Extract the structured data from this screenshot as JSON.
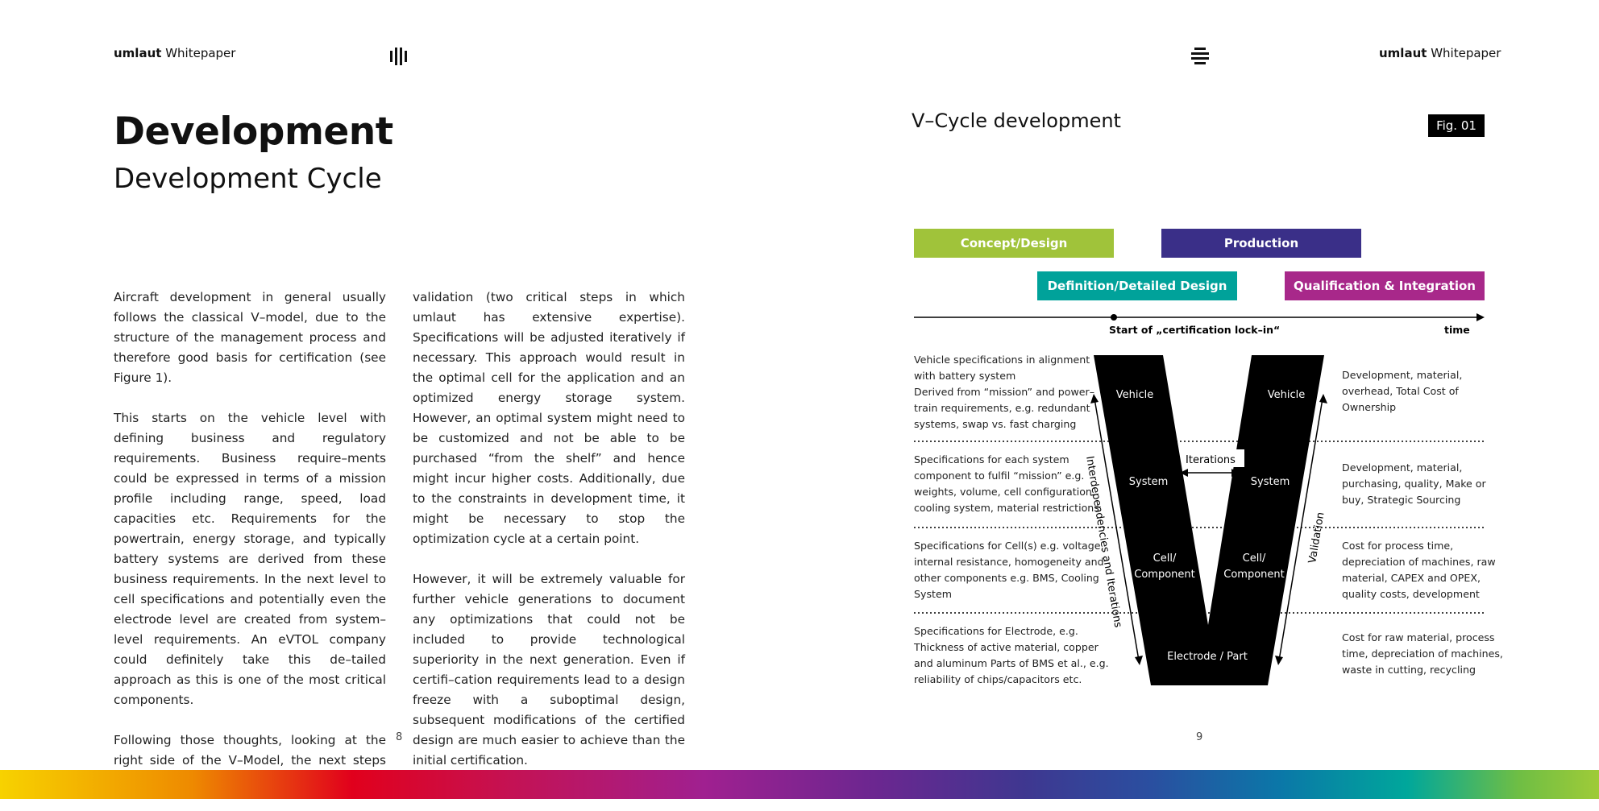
{
  "header": {
    "brand": "umlaut",
    "left_label": "Whitepaper",
    "right_label": "Whitepaper"
  },
  "left_page": {
    "title": "Development",
    "subtitle": "Development Cycle",
    "col1": [
      "Aircraft development in general usually follows the classical V–model, due to the structure of the management process and therefore good basis for certification (see Figure 1).",
      "This starts on the vehicle level with defining business and regulatory requirements. Business require–ments could be expressed in terms of a mission profile including range, speed, load capacities etc. Requirements for the powertrain, energy storage, and typically battery systems are derived from these business requirements. In the next level to cell specifications and potentially even the electrode level are created from system–level requirements. An eVTOL company could definitely take this de–tailed approach as this is one of the most critical components.",
      "Following those thoughts, looking at the right side of the V–Model, the next steps are testing and"
    ],
    "col2": [
      "validation (two critical steps in which umlaut has extensive expertise). Specifications will be adjusted iteratively if necessary. This approach would result in the optimal cell for the application and an optimized energy storage system. However, an optimal system might need to be customized and not be able to be purchased “from the shelf” and hence might incur higher costs. Additionally, due to the constraints in development time, it might be necessary to stop the optimization cycle at a certain point.",
      "However, it will be extremely valuable for further vehicle generations to document any optimizations that could not be included to provide technological superiority in the next generation. Even if certifi–cation requirements lead to a design freeze with a suboptimal design, subsequent modifications of the certified design are much easier to achieve than the initial certification."
    ],
    "page_number": "8"
  },
  "right_page": {
    "fig_title": "V–Cycle development",
    "fig_label": "Fig. 01",
    "phases": {
      "concept": "Concept/Design",
      "production": "Production",
      "definition": "Definition/Detailed Design",
      "qualification": "Qualification & Integration"
    },
    "colors": {
      "concept": "#a0c33a",
      "production": "#3a2f88",
      "definition": "#00a29a",
      "qualification": "#a8288a"
    },
    "timeline": {
      "lock_in": "Start of „certification lock–in“",
      "time": "time"
    },
    "v_labels": {
      "vehicle_left": "Vehicle",
      "vehicle_right": "Vehicle",
      "system_left": "System",
      "system_right": "System",
      "cell_left_1": "Cell/",
      "cell_left_2": "Component",
      "cell_right_1": "Cell/",
      "cell_right_2": "Component",
      "electrode": "Electrode / Part",
      "iterations": "Iterations",
      "interdependencies": "Interdependencies and Iterations",
      "validation": "Validation"
    },
    "left_desc": [
      [
        "Vehicle specifications in alignment",
        "with battery system",
        "Derived from “mission” and power–",
        "train requirements, e.g. redundant",
        "systems, swap vs. fast charging"
      ],
      [
        "Specifications for each system",
        "component to fulfil “mission” e.g.",
        "weights, volume, cell configuration,",
        "cooling system, material restrictions"
      ],
      [
        "Specifications for Cell(s) e.g. voltage,",
        "internal resistance, homogeneity and",
        "other components e.g. BMS, Cooling",
        "System"
      ],
      [
        "Specifications for Electrode, e.g.",
        "Thickness of active material, copper",
        "and aluminum Parts of BMS et al., e.g.",
        "reliability of chips/capacitors etc."
      ]
    ],
    "right_desc": [
      [
        "Development, material,",
        "overhead, Total Cost of",
        "Ownership"
      ],
      [
        "Development, material,",
        "purchasing, quality, Make or",
        "buy, Strategic Sourcing"
      ],
      [
        "Cost for process time,",
        "depreciation of machines, raw",
        "material, CAPEX and OPEX,",
        "quality costs, development"
      ],
      [
        "Cost for raw material, process",
        "time, depreciation of machines,",
        "waste in cutting, recycling"
      ]
    ],
    "page_number": "9"
  }
}
